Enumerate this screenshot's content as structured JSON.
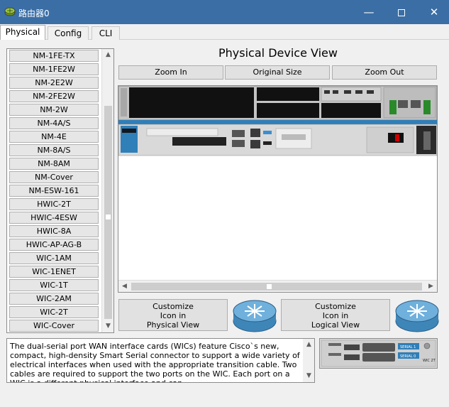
{
  "window": {
    "title": "路由器0",
    "close_glyph": "✕",
    "minimize_glyph": "—"
  },
  "tabs": [
    {
      "label": "Physical",
      "active": true
    },
    {
      "label": "Config",
      "active": false
    },
    {
      "label": "CLI",
      "active": false
    }
  ],
  "modules": [
    "NM-1FE-TX",
    "NM-1FE2W",
    "NM-2E2W",
    "NM-2FE2W",
    "NM-2W",
    "NM-4A/S",
    "NM-4E",
    "NM-8A/S",
    "NM-8AM",
    "NM-Cover",
    "NM-ESW-161",
    "HWIC-2T",
    "HWIC-4ESW",
    "HWIC-8A",
    "HWIC-AP-AG-B",
    "WIC-1AM",
    "WIC-1ENET",
    "WIC-1T",
    "WIC-2AM",
    "WIC-2T",
    "WIC-Cover"
  ],
  "device_view": {
    "title": "Physical Device View",
    "zoom_in": "Zoom In",
    "original_size": "Original Size",
    "zoom_out": "Zoom Out"
  },
  "customize": {
    "physical": [
      "Customize",
      "Icon in",
      "Physical View"
    ],
    "logical": [
      "Customize",
      "Icon in",
      "Logical View"
    ]
  },
  "description": "The dual-serial port WAN interface cards (WICs) feature Cisco`s new, compact, high-density Smart Serial connector to support a wide variety of electrical interfaces when used with the appropriate transition cable. Two cables are required to support the two ports on the WIC. Each port on a WIC is a different physical interface and can",
  "preview": {
    "port_labels": [
      "SERIAL 1",
      "SERIAL 0"
    ],
    "card_label": "WIC 2T"
  },
  "colors": {
    "titlebar": "#3a6ea5",
    "panel": "#f0f0f0",
    "router_blue": "#2f7fb8"
  }
}
